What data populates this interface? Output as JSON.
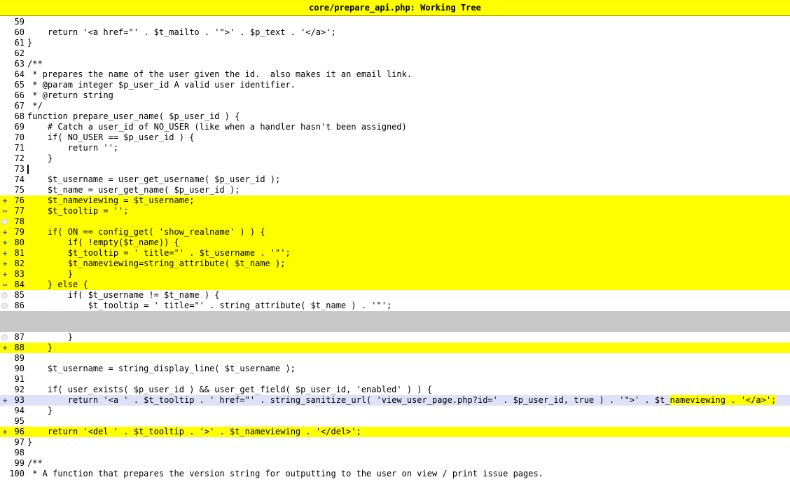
{
  "window": {
    "title": "core/prepare_api.php: Working Tree"
  },
  "icons": {
    "added": "plus-icon",
    "changed": "double-arrow-icon",
    "removed": "gray-dot-icon"
  },
  "colors": {
    "added_bg": "#ffff00",
    "modified_bg": "#e0e0f8",
    "gap_bg": "#c8c8c8",
    "marker": "#3060b0"
  },
  "lines": [
    {
      "n": "59",
      "text": "",
      "state": ""
    },
    {
      "n": "60",
      "text": "    return '<a href=\"' . $t_mailto . '\">' . $p_text . '</a>';",
      "state": ""
    },
    {
      "n": "61",
      "text": "}",
      "state": ""
    },
    {
      "n": "62",
      "text": "",
      "state": ""
    },
    {
      "n": "63",
      "text": "/**",
      "state": ""
    },
    {
      "n": "64",
      "text": " * prepares the name of the user given the id.  also makes it an email link.",
      "state": ""
    },
    {
      "n": "65",
      "text": " * @param integer $p_user_id A valid user identifier.",
      "state": ""
    },
    {
      "n": "66",
      "text": " * @return string",
      "state": ""
    },
    {
      "n": "67",
      "text": " */",
      "state": ""
    },
    {
      "n": "68",
      "text": "function prepare_user_name( $p_user_id ) {",
      "state": ""
    },
    {
      "n": "69",
      "text": "    # Catch a user_id of NO_USER (like when a handler hasn't been assigned)",
      "state": ""
    },
    {
      "n": "70",
      "text": "    if( NO_USER == $p_user_id ) {",
      "state": ""
    },
    {
      "n": "71",
      "text": "        return '';",
      "state": ""
    },
    {
      "n": "72",
      "text": "    }",
      "state": ""
    },
    {
      "n": "73",
      "text": "",
      "state": "",
      "cursor": true
    },
    {
      "n": "74",
      "text": "    $t_username = user_get_username( $p_user_id );",
      "state": ""
    },
    {
      "n": "75",
      "text": "    $t_name = user_get_name( $p_user_id );",
      "state": ""
    },
    {
      "n": "76",
      "text": "    $t_nameviewing = $t_username;",
      "state": "added",
      "marker": "plus"
    },
    {
      "n": "77",
      "text": "    $t_tooltip = '';",
      "state": "added",
      "marker": "arrow"
    },
    {
      "n": "78",
      "text": "",
      "state": "added",
      "marker": "dot"
    },
    {
      "n": "79",
      "text": "    if( ON == config_get( 'show_realname' ) ) {",
      "state": "added",
      "marker": "plus"
    },
    {
      "n": "80",
      "text": "        if( !empty($t_name)) {",
      "state": "added",
      "marker": "plus"
    },
    {
      "n": "81",
      "text": "        $t_tooltip = ' title=\"' . $t_username . '\"';",
      "state": "added",
      "marker": "plus"
    },
    {
      "n": "82",
      "text": "        $t_nameviewing=string_attribute( $t_name );",
      "state": "added",
      "marker": "plus"
    },
    {
      "n": "83",
      "text": "        }",
      "state": "added",
      "marker": "plus"
    },
    {
      "n": "84",
      "text": "    } else {",
      "state": "added",
      "marker": "arrow"
    },
    {
      "n": "85",
      "text": "        if( $t_username != $t_name ) {",
      "state": "",
      "marker": "dot"
    },
    {
      "n": "86",
      "text": "            $t_tooltip = ' title=\"' . string_attribute( $t_name ) . '\"';",
      "state": "",
      "marker": "dot"
    },
    {
      "n": "",
      "text": "",
      "state": "gap"
    },
    {
      "n": "87",
      "text": "        }",
      "state": "",
      "marker": "dot"
    },
    {
      "n": "88",
      "text": "    }",
      "state": "added",
      "marker": "plus"
    },
    {
      "n": "89",
      "text": "",
      "state": ""
    },
    {
      "n": "90",
      "text": "    $t_username = string_display_line( $t_username );",
      "state": ""
    },
    {
      "n": "91",
      "text": "",
      "state": ""
    },
    {
      "n": "92",
      "text": "    if( user_exists( $p_user_id ) && user_get_field( $p_user_id, 'enabled' ) ) {",
      "state": ""
    },
    {
      "n": "93",
      "text": "        return '<a ' . $t_tooltip . ' href=\"' . string_sanitize_url( 'view_user_page.php?id=' . $p_user_id, true ) . '\">' . $t_",
      "hl": "nameviewing",
      "after": " . '</a>';",
      "state": "mod",
      "marker": "plus"
    },
    {
      "n": "94",
      "text": "    }",
      "state": ""
    },
    {
      "n": "95",
      "text": "",
      "state": ""
    },
    {
      "n": "96",
      "text": "    return '<del ' . $t_tooltip . '>' . $t_",
      "hl": "nameviewing",
      "after": " . '</del>';",
      "state": "added",
      "marker": "plus"
    },
    {
      "n": "97",
      "text": "}",
      "state": ""
    },
    {
      "n": "98",
      "text": "",
      "state": ""
    },
    {
      "n": "99",
      "text": "/**",
      "state": ""
    },
    {
      "n": "100",
      "text": " * A function that prepares the version string for outputting to the user on view / print issue pages.",
      "state": ""
    }
  ]
}
